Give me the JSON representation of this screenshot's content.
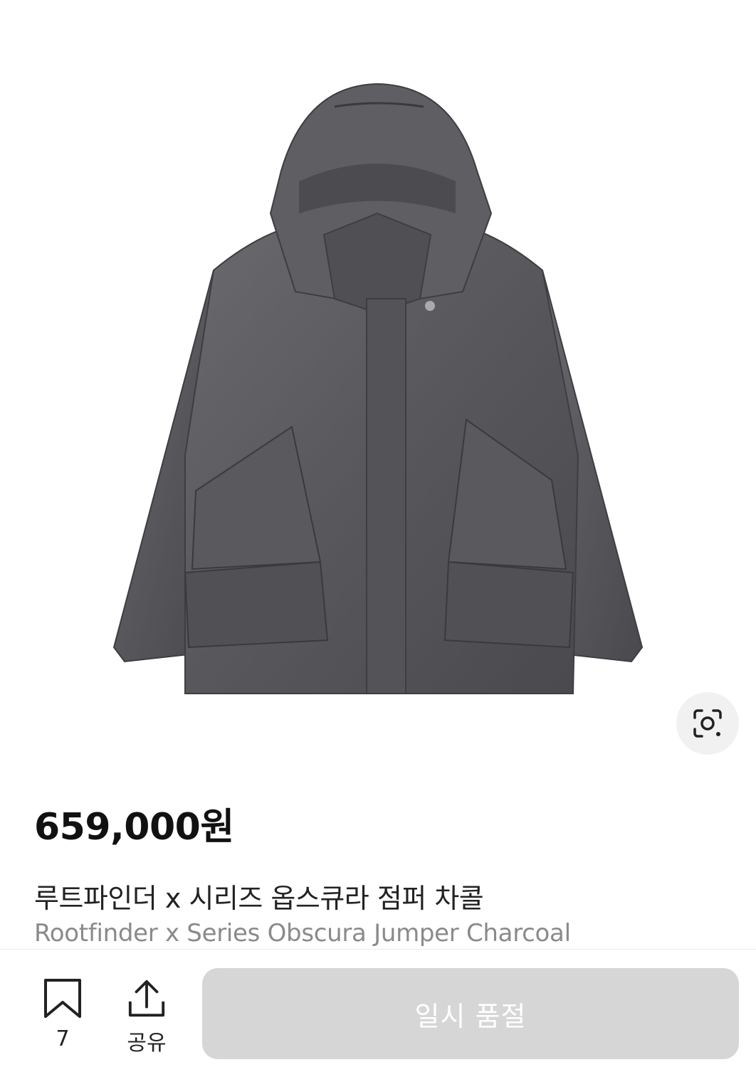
{
  "product": {
    "price": "659,000원",
    "name_ko": "루트파인더 x 시리즈 옵스큐라 점퍼 차콜",
    "name_en": "Rootfinder x Series Obscura Jumper Charcoal",
    "image_icon": "jacket-photo",
    "lens_icon": "image-search-lens-icon"
  },
  "actions": {
    "bookmark_count": "7",
    "share_label": "공유",
    "soldout_label": "일시 품절"
  },
  "colors": {
    "jacket": "#5b5b5f",
    "button_disabled": "#d6d6d6",
    "secondary_text": "#8a8a8a"
  }
}
